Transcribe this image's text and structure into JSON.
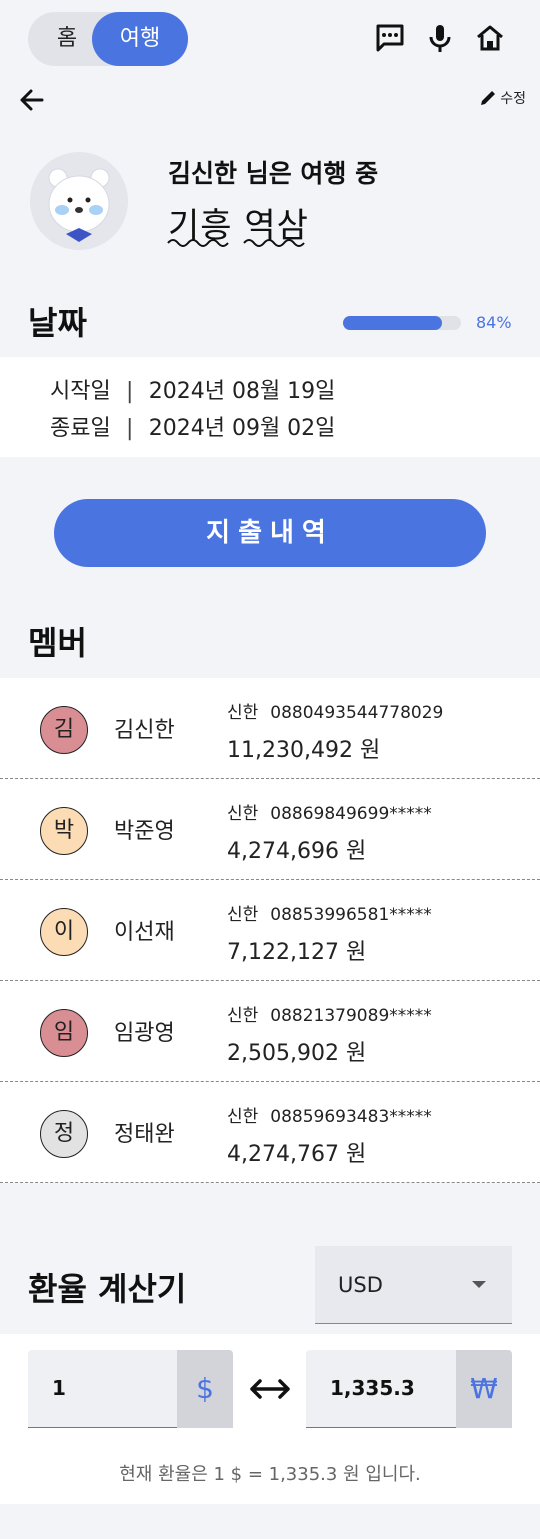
{
  "topbar": {
    "toggle_home": "홈",
    "toggle_trip": "여행",
    "icons": [
      "chat-icon",
      "microphone-icon",
      "home-icon"
    ]
  },
  "header": {
    "edit_label": "수정"
  },
  "profile": {
    "title": "김신한 님은 여행 중",
    "trip_name": "기흥 역삼"
  },
  "dates": {
    "heading": "날짜",
    "progress_label": "84%",
    "progress_value": 0.84,
    "start_label": "시작일",
    "start_value": "2024년 08월 19일",
    "end_label": "종료일",
    "end_value": "2024년 09월 02일",
    "separator": "|"
  },
  "expense_button": "지출내역",
  "members": {
    "heading": "멤버",
    "list": [
      {
        "badge": "김",
        "name": "김신한",
        "bank": "신한",
        "account": "0880493544778029",
        "balance": "11,230,492 원",
        "color": "#d98e93"
      },
      {
        "badge": "박",
        "name": "박준영",
        "bank": "신한",
        "account": "08869849699*****",
        "balance": "4,274,696 원",
        "color": "#fcdcb4"
      },
      {
        "badge": "이",
        "name": "이선재",
        "bank": "신한",
        "account": "08853996581*****",
        "balance": "7,122,127 원",
        "color": "#fcdcb4"
      },
      {
        "badge": "임",
        "name": "임광영",
        "bank": "신한",
        "account": "08821379089*****",
        "balance": "2,505,902 원",
        "color": "#d98e93"
      },
      {
        "badge": "정",
        "name": "정태완",
        "bank": "신한",
        "account": "08859693483*****",
        "balance": "4,274,767 원",
        "color": "#e2e2e2"
      }
    ]
  },
  "exchange": {
    "heading": "환율 계산기",
    "currency": "USD",
    "from_value": "1",
    "from_symbol": "$",
    "to_value": "1,335.3",
    "to_symbol": "₩",
    "note": "현재 환율은 1 $  =  1,335.3 원 입니다."
  },
  "colors": {
    "accent": "#4a74e0",
    "background": "#f3f4f8"
  }
}
